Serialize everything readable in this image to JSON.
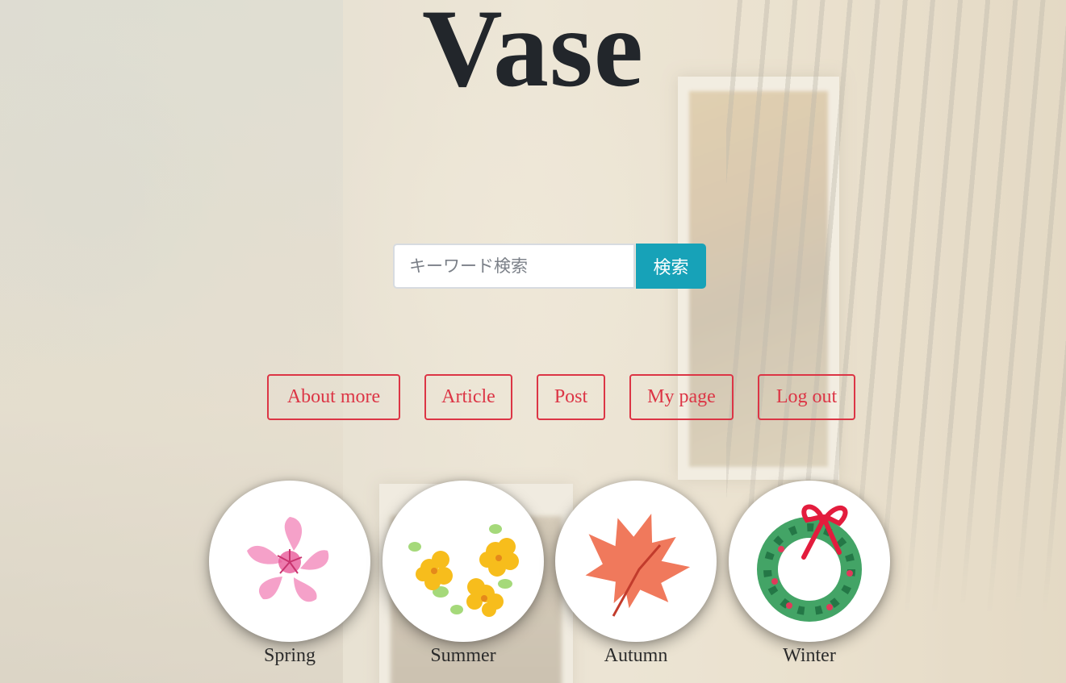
{
  "site": {
    "title": "Vase"
  },
  "search": {
    "placeholder": "キーワード検索",
    "button_label": "検索"
  },
  "nav": {
    "items": [
      {
        "label": "About more"
      },
      {
        "label": "Article"
      },
      {
        "label": "Post"
      },
      {
        "label": "My page"
      },
      {
        "label": "Log out"
      }
    ]
  },
  "seasons": {
    "items": [
      {
        "label": "Spring",
        "icon": "cherry-blossom-icon"
      },
      {
        "label": "Summer",
        "icon": "yellow-flowers-icon"
      },
      {
        "label": "Autumn",
        "icon": "maple-leaf-icon"
      },
      {
        "label": "Winter",
        "icon": "wreath-icon"
      }
    ]
  },
  "colors": {
    "nav_accent": "#dc3545",
    "search_button": "#17a2b8",
    "title": "#22262b"
  }
}
